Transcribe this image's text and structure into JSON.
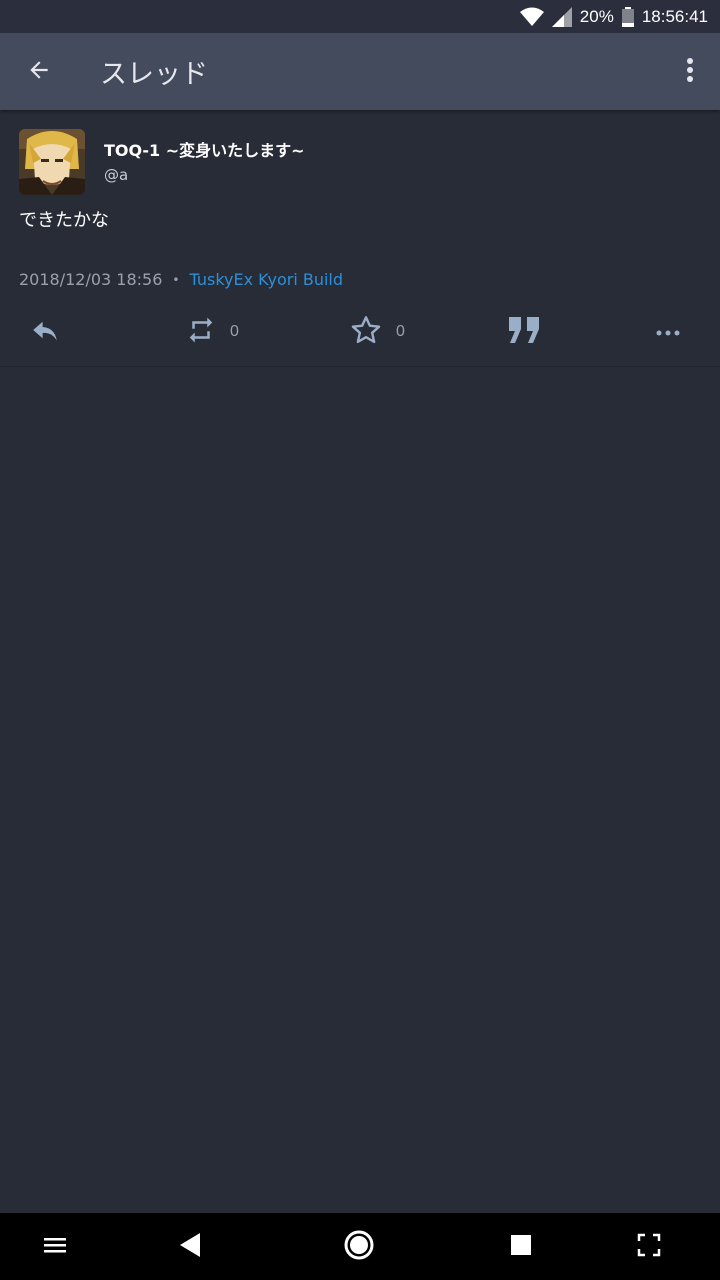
{
  "status_bar": {
    "battery": "20%",
    "time": "18:56:41"
  },
  "app_bar": {
    "title": "スレッド"
  },
  "status": {
    "display_name": "TOQ-1 ~変身いたします~",
    "username": "@a",
    "content": "できたかな",
    "timestamp": "2018/12/03 18:56",
    "separator": "•",
    "application": "TuskyEx Kyori Build",
    "reblog_count": "0",
    "favourite_count": "0"
  },
  "colors": {
    "background": "#282c37",
    "app_bar": "#444b5d",
    "accent_link": "#2b90d9",
    "action_icon": "#9baec8"
  },
  "icons": {
    "back": "arrow-left-icon",
    "menu": "more-vert-icon",
    "reply": "reply-icon",
    "reblog": "repeat-icon",
    "favourite": "star-outline-icon",
    "quote": "quote-icon",
    "more": "more-horiz-icon"
  }
}
